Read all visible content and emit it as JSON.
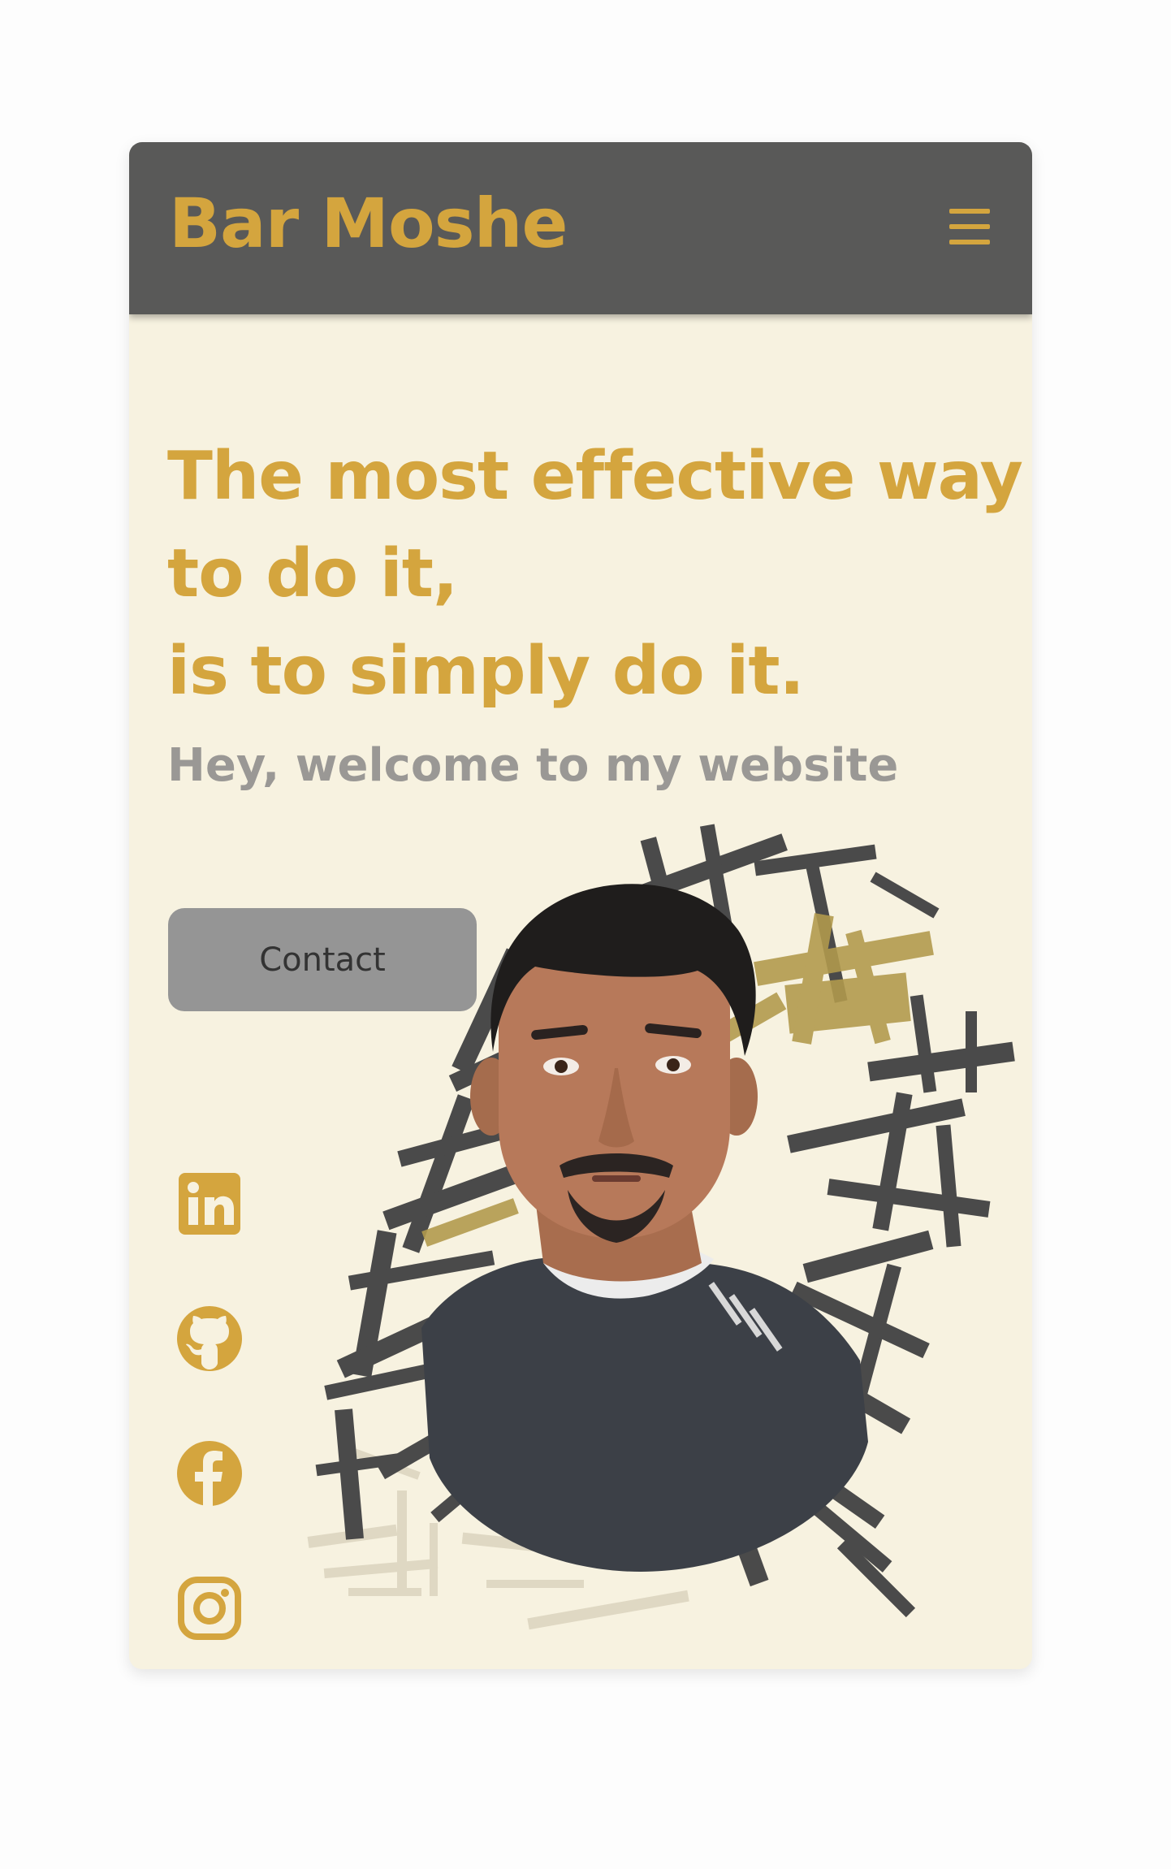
{
  "brand": {
    "name": "Bar Moshe"
  },
  "nav": {
    "menu_icon": "hamburger-menu-icon"
  },
  "hero": {
    "headline_lines": [
      "The most effective way",
      "to do it,",
      "is to simply do it."
    ],
    "subheading": "Hey, welcome to my website",
    "contact_label": "Contact"
  },
  "social": [
    {
      "name": "LinkedIn",
      "icon": "linkedin-icon"
    },
    {
      "name": "GitHub",
      "icon": "github-icon"
    },
    {
      "name": "Facebook",
      "icon": "facebook-icon"
    },
    {
      "name": "Instagram",
      "icon": "instagram-icon"
    }
  ],
  "colors": {
    "accent": "#d4a53e",
    "navbar": "#595958",
    "background": "#f7f2e0",
    "subheading": "#9a9895",
    "button": "#959595",
    "ink": "#4a4a4a",
    "ochre": "#b29a4d"
  }
}
